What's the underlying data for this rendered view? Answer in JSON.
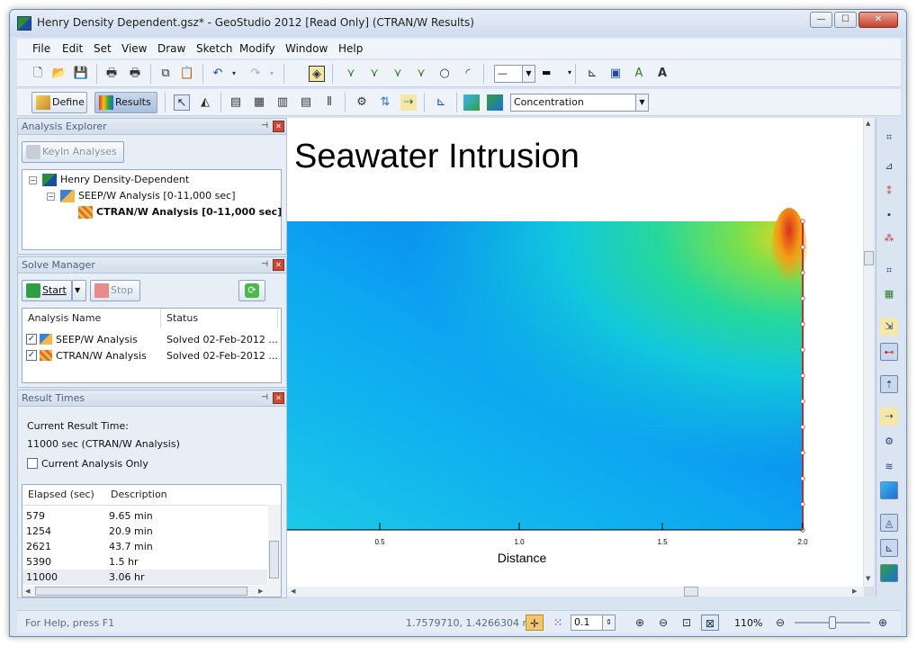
{
  "window": {
    "title": "Henry Density Dependent.gsz* - GeoStudio 2012 [Read Only] (CTRAN/W Results)",
    "minimize_glyph": "—",
    "maximize_glyph": "☐",
    "close_glyph": "✕"
  },
  "menu": [
    "File",
    "Edit",
    "Set",
    "View",
    "Draw",
    "Sketch",
    "Modify",
    "Window",
    "Help"
  ],
  "toolbar2": {
    "define_label": "Define",
    "results_label": "Results",
    "contour_select": "Concentration"
  },
  "analysis_explorer": {
    "title": "Analysis Explorer",
    "keyin_button": "KeyIn Analyses",
    "tree": [
      {
        "label": "Henry Density-Dependent",
        "bold": false
      },
      {
        "label": "SEEP/W Analysis [0-11,000 sec]",
        "bold": false
      },
      {
        "label": "CTRAN/W Analysis [0-11,000 sec]",
        "bold": true
      }
    ]
  },
  "solve_manager": {
    "title": "Solve Manager",
    "start_button": "Start",
    "stop_button": "Stop",
    "columns": [
      "Analysis Name",
      "Status"
    ],
    "rows": [
      {
        "name": "SEEP/W Analysis",
        "status": "Solved 02-Feb-2012 ...",
        "checked": true
      },
      {
        "name": "CTRAN/W Analysis",
        "status": "Solved 02-Feb-2012 ...",
        "checked": true
      }
    ]
  },
  "result_times": {
    "title": "Result Times",
    "current_label": "Current Result Time:",
    "current_value": "11000 sec (CTRAN/W Analysis)",
    "current_only_label": "Current Analysis Only",
    "columns": [
      "Elapsed (sec)",
      "Description"
    ],
    "rows": [
      {
        "elapsed": "579",
        "description": "9.65 min"
      },
      {
        "elapsed": "1254",
        "description": "20.9 min"
      },
      {
        "elapsed": "2621",
        "description": "43.7 min"
      },
      {
        "elapsed": "5390",
        "description": "1.5 hr"
      },
      {
        "elapsed": "11000",
        "description": "3.06 hr"
      }
    ]
  },
  "drawing": {
    "title": "Seawater Intrusion",
    "x_axis_label": "Distance",
    "x_ticks": [
      "0.5",
      "1.0",
      "1.5",
      "2.0"
    ]
  },
  "status": {
    "help": "For Help, press F1",
    "coordinates": "1.7579710, 1.4266304 m",
    "grid_spacing": "0.1",
    "zoom": "110%"
  }
}
